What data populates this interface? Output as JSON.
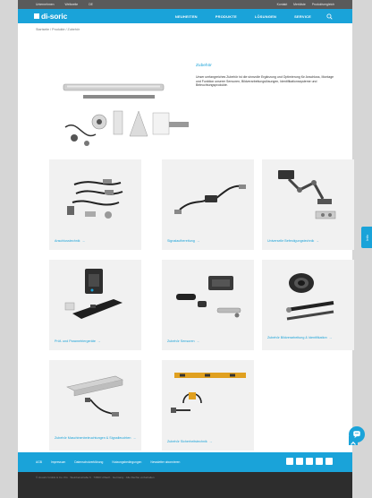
{
  "topbar": {
    "left": [
      "Unternehmen",
      "Weltweite",
      "DE"
    ],
    "right": [
      "Kontakt",
      "Merkliste",
      "Produktvergleich"
    ]
  },
  "brand": {
    "logo_text": "di-soric"
  },
  "nav": [
    "NEUHEITEN",
    "PRODUKTE",
    "LÖSUNGEN",
    "SERVICE"
  ],
  "breadcrumb": "Startseite / Produkte / Zubehör",
  "intro": {
    "title": "Zubehör",
    "text": "Unser umfangreiches Zubehör ist die sinnvolle Ergänzung und Optimierung für Anschluss, Montage und Funktion unserer Sensoren, Bildverarbeitungslösungen, Identifikationssysteme und Beleuchtungsprodukte."
  },
  "tiles": [
    {
      "label": "Anschlusstechnik",
      "arrow": "→"
    },
    {
      "label": "Signalaufbereitung",
      "arrow": "→"
    },
    {
      "label": "Universelle Befestigungstechnik",
      "arrow": "→"
    },
    {
      "label": "Prüf- und Parametriergeräte",
      "arrow": "→"
    },
    {
      "label": "Zubehör Sensoren",
      "arrow": "→"
    },
    {
      "label": "Zubehör Bildverarbeitung & Identifikation",
      "arrow": "→"
    },
    {
      "label": "Zubehör Maschinenbeleuchtungen & Signalleuchten",
      "arrow": "→"
    },
    {
      "label": "Zubehör Sicherheitstechnik",
      "arrow": "→"
    }
  ],
  "side_tab": "Info",
  "footer": {
    "links": [
      "AGB",
      "Impressum",
      "Datenschutzerklärung",
      "Nutzungsbedingungen",
      "Newsletter abonnieren"
    ],
    "bottom_text": "© di-soric GmbH & Co. KG · Steinbeisstraße 6 · 73660 Urbach · Germany · Alle Rechte vorbehalten"
  },
  "colors": {
    "accent": "#1aa3d9",
    "topbar": "#5a5a5a",
    "tile_bg": "#f1f1f1",
    "footer_dark": "#2d2d2d"
  }
}
